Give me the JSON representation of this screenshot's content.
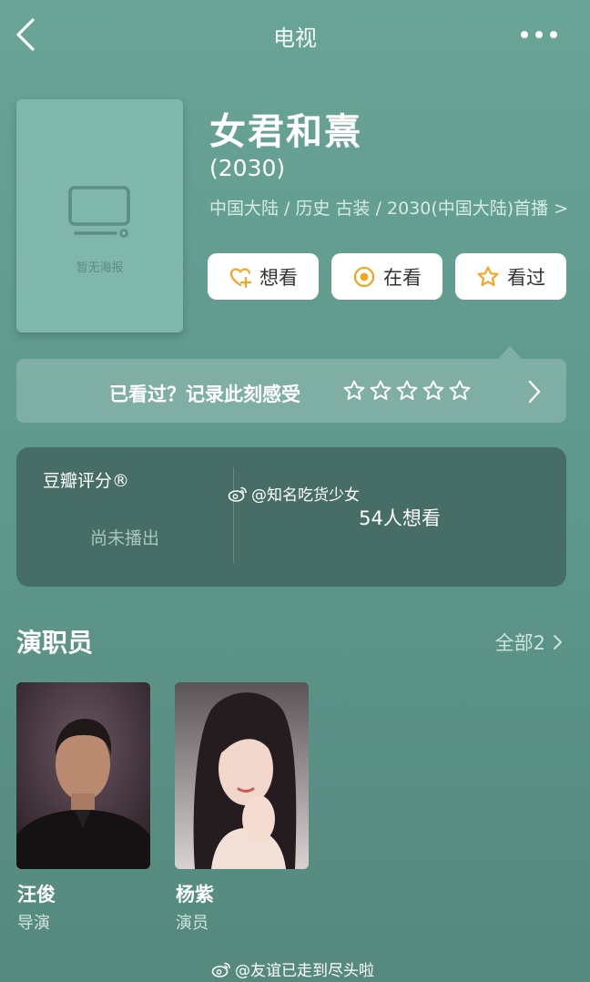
{
  "header": {
    "title": "电视",
    "back_icon": "chevron-left-icon",
    "more_icon": "more-dots-icon"
  },
  "poster": {
    "placeholder_text": "暂无海报",
    "icon": "tv-icon"
  },
  "show": {
    "title": "女君和熹",
    "year": "(2030)",
    "meta": "中国大陆 / 历史 古装 / 2030(中国大陆)首播 >"
  },
  "actions": {
    "want": "想看",
    "watching": "在看",
    "watched": "看过",
    "accent_color": "#f5a623"
  },
  "record": {
    "prompt": "已看过？记录此刻感受",
    "stars": 5
  },
  "rating": {
    "label": "豆瓣评分®",
    "status": "尚未播出",
    "want_count": "54人想看"
  },
  "watermarks": {
    "top": "@知名吃货少女",
    "bottom": "@友谊已走到尽头啦"
  },
  "cast": {
    "heading": "演职员",
    "all_label": "全部2",
    "members": [
      {
        "name": "汪俊",
        "role": "导演"
      },
      {
        "name": "杨紫",
        "role": "演员"
      }
    ]
  }
}
